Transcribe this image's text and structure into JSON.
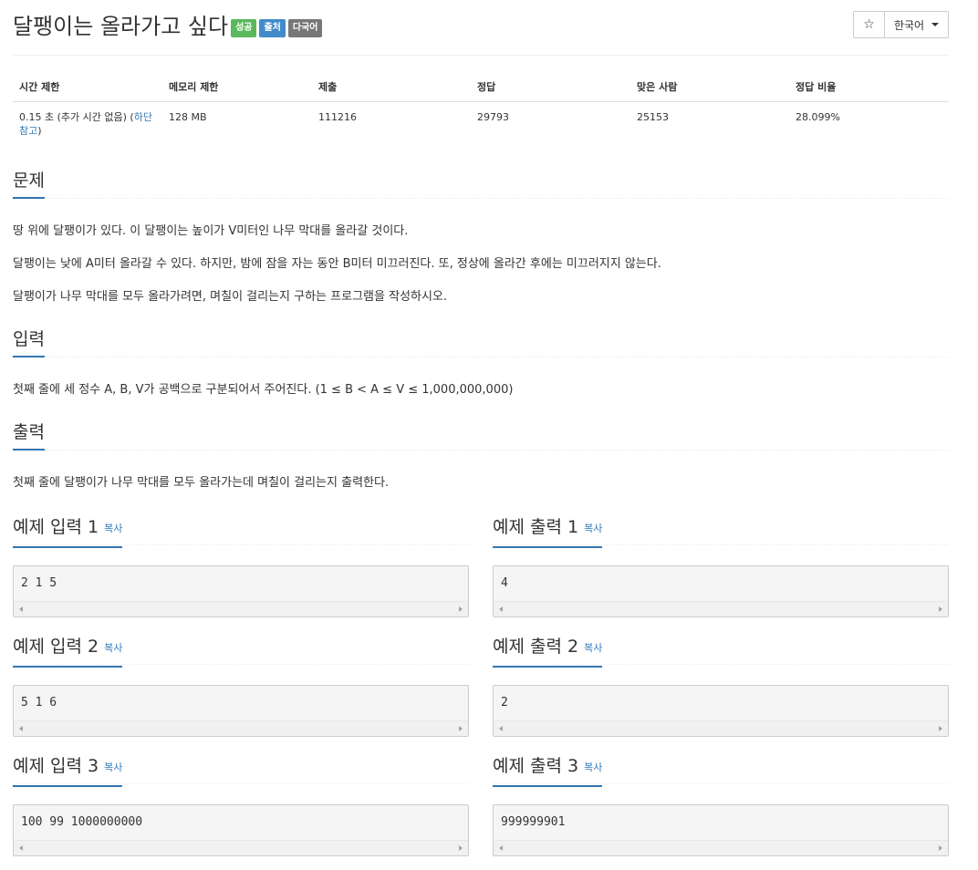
{
  "problem": {
    "title": "달팽이는 올라가고 싶다",
    "labels": [
      "성공",
      "출처",
      "다국어"
    ]
  },
  "toolbar": {
    "star_icon": "☆",
    "language": "한국어"
  },
  "info_table": {
    "headers": [
      "시간 제한",
      "메모리 제한",
      "제출",
      "정답",
      "맞은 사람",
      "정답 비율"
    ],
    "time_limit_prefix": "0.15 초 (추가 시간 없음) (",
    "time_limit_link_1": "하단",
    "time_limit_link_2": "참고",
    "time_limit_suffix": ")",
    "memory_limit": "128 MB",
    "submissions": "111216",
    "accepted": "29793",
    "solved_users": "25153",
    "ratio": "28.099%"
  },
  "sections": {
    "description": {
      "heading": "문제",
      "paragraphs": [
        "땅 위에 달팽이가 있다. 이 달팽이는 높이가 V미터인 나무 막대를 올라갈 것이다.",
        "달팽이는 낮에 A미터 올라갈 수 있다. 하지만, 밤에 잠을 자는 동안 B미터 미끄러진다. 또, 정상에 올라간 후에는 미끄러지지 않는다.",
        "달팽이가 나무 막대를 모두 올라가려면, 며칠이 걸리는지 구하는 프로그램을 작성하시오."
      ]
    },
    "input": {
      "heading": "입력",
      "text": "첫째 줄에 세 정수 A, B, V가 공백으로 구분되어서 주어진다. (1 ≤ B < A ≤ V ≤ 1,000,000,000)"
    },
    "output": {
      "heading": "출력",
      "text": "첫째 줄에 달팽이가 나무 막대를 모두 올라가는데 며칠이 걸리는지 출력한다."
    }
  },
  "samples": {
    "copy_label": "복사",
    "items": [
      {
        "input_heading": "예제 입력 1",
        "input": "2 1 5",
        "output_heading": "예제 출력 1",
        "output": "4"
      },
      {
        "input_heading": "예제 입력 2",
        "input": "5 1 6",
        "output_heading": "예제 출력 2",
        "output": "2"
      },
      {
        "input_heading": "예제 입력 3",
        "input": "100 99 1000000000",
        "output_heading": "예제 출력 3",
        "output": "999999901"
      }
    ]
  },
  "colors": {
    "success": "#5cb85c",
    "primary": "#428bca",
    "default": "#777777",
    "link": "#337ab7",
    "heading_underline": "#3276b1"
  }
}
